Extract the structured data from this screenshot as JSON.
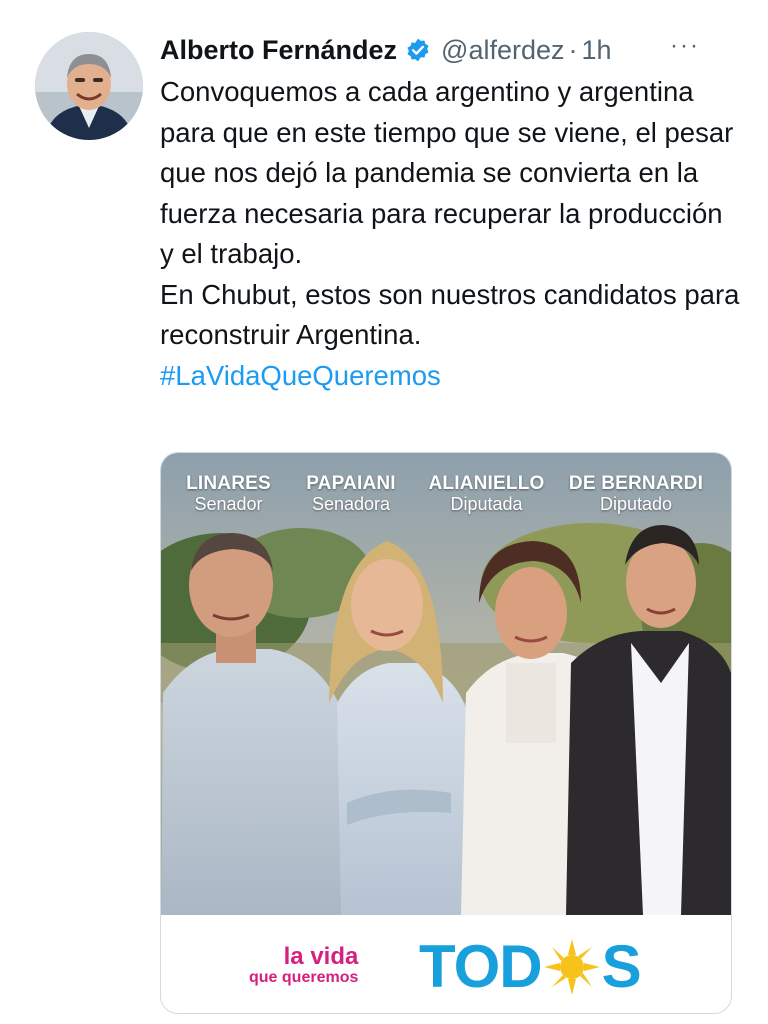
{
  "tweet": {
    "author_name": "Alberto Fernández",
    "handle": "@alferdez",
    "separator": "·",
    "time": "1h",
    "more_label": "···",
    "paragraphs": [
      "Convoquemos a cada argentino y argentina para que en este tiempo que se viene, el pesar que nos dejó la pandemia se convierta en la fuerza necesaria para recuperar la producción y el trabajo.",
      "En Chubut, estos son nuestros candidatos para reconstruir Argentina."
    ],
    "hashtag": "#LaVidaQueQueremos"
  },
  "media": {
    "candidates": [
      {
        "name": "LINARES",
        "role": "Senador"
      },
      {
        "name": "PAPAIANI",
        "role": "Senadora"
      },
      {
        "name": "ALIANIELLO",
        "role": "Diputada"
      },
      {
        "name": "DE BERNARDI",
        "role": "Diputado"
      }
    ],
    "footer_line1": "la vida",
    "footer_line2": "que queremos",
    "brand_left": "TOD",
    "brand_right": "S"
  },
  "colors": {
    "hashtag": "#1d9bf0",
    "brand_blue": "#18a0dc",
    "brand_pink": "#d6207f",
    "sun_yellow": "#f7c21a",
    "verified_blue": "#1d9bf0"
  },
  "icons": {
    "verified": "verified-badge-icon",
    "more": "more-options-icon",
    "sun": "sun-icon"
  }
}
